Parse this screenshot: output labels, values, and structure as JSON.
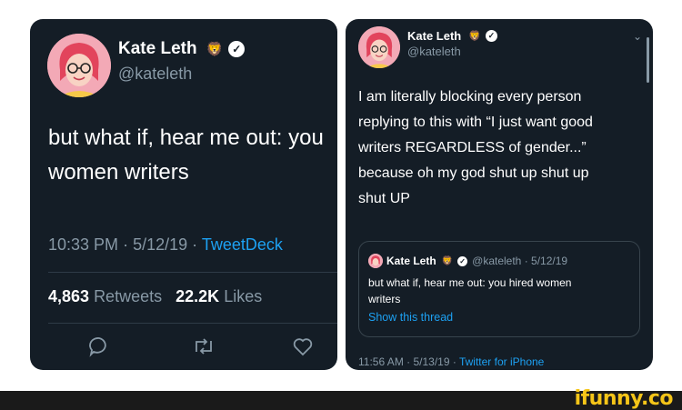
{
  "left_tweet": {
    "author_name": "Kate Leth",
    "author_emoji": "🦁",
    "verified_mark": "✓",
    "handle": "@kateleth",
    "text": "but what if, hear me out: you\nwomen writers",
    "time": "10:33 PM",
    "date": "5/12/19",
    "separator": "·",
    "source": "TweetDeck",
    "retweets_count": "4,863",
    "retweets_label": "Retweets",
    "likes_count": "22.2K",
    "likes_label": "Likes",
    "icons": [
      "reply-icon",
      "retweet-icon",
      "like-icon"
    ]
  },
  "right_tweet": {
    "author_name": "Kate Leth",
    "author_emoji": "🦁",
    "verified_mark": "✓",
    "handle": "@kateleth",
    "chevron": "⌄",
    "text": "I am literally blocking every person\nreplying to this with “I just want good\nwriters REGARDLESS of gender...”\nbecause oh my god shut up shut up\nshut UP",
    "quote": {
      "author_name": "Kate Leth",
      "author_emoji": "🦁",
      "verified_mark": "✓",
      "handle": "@kateleth",
      "date": "5/12/19",
      "separator": "·",
      "text": "but what if, hear me out: you hired women\nwriters",
      "link": "Show this thread"
    },
    "meta": "11:56 AM · 5/13/19 · ",
    "source": "Twitter for iPhone"
  },
  "footer": {
    "logo": "ifunny.co"
  },
  "colors": {
    "panel": "#141d26",
    "accent": "#1da1f2",
    "muted": "#8899a6",
    "logo": "#f5c518"
  }
}
